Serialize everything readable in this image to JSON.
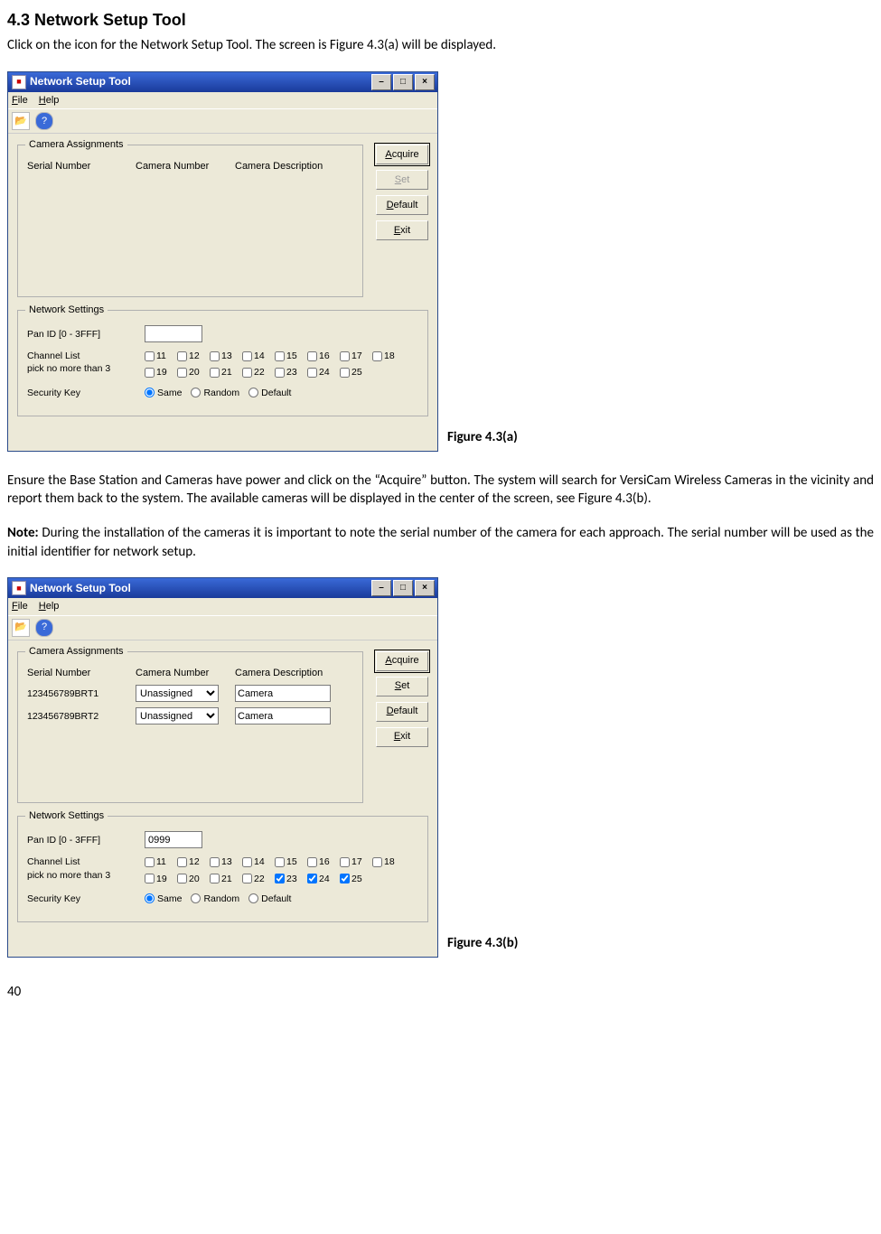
{
  "doc": {
    "heading": "4.3 Network Setup Tool",
    "intro": "Click on the icon for the Network Setup Tool. The screen is Figure 4.3(a) will be displayed.",
    "caption_a": "Figure 4.3(a)",
    "para2": "Ensure the Base Station and Cameras have power and click on the “Acquire” button. The system will search for VersiCam Wireless Cameras in the vicinity and report them back to the system. The available cameras will be displayed in the center of the screen, see Figure 4.3(b).",
    "note_label": "Note:",
    "note_body": " During the installation of the cameras it is important to note the serial number of the camera for each approach. The serial number will be used as the initial identifier for network setup.",
    "caption_b": "Figure 4.3(b)",
    "page_num": "40"
  },
  "win": {
    "title": "Network Setup Tool",
    "minimize": "–",
    "maximize": "□",
    "close": "×",
    "menu_file": "File",
    "menu_help": "Help",
    "group_assign": "Camera Assignments",
    "col_serial": "Serial Number",
    "col_camnum": "Camera Number",
    "col_desc": "Camera Description",
    "btn_acquire": "Acquire",
    "btn_set": "Set",
    "btn_default": "Default",
    "btn_exit": "Exit",
    "group_net": "Network Settings",
    "label_pan": "Pan ID [0 - 3FFF]",
    "label_chanlist": "Channel List",
    "label_chanlist2": "pick no more than 3",
    "label_seckey": "Security Key",
    "radio_same": "Same",
    "radio_random": "Random",
    "radio_default": "Default",
    "channels": [
      "11",
      "12",
      "13",
      "14",
      "15",
      "16",
      "17",
      "18",
      "19",
      "20",
      "21",
      "22",
      "23",
      "24",
      "25"
    ]
  },
  "figA": {
    "pan_value": "",
    "checked_channels": [],
    "rows": []
  },
  "figB": {
    "pan_value": "0999",
    "checked_channels": [
      "23",
      "24",
      "25"
    ],
    "rows": [
      {
        "serial": "123456789BRT1",
        "camnum": "Unassigned",
        "desc": "Camera"
      },
      {
        "serial": "123456789BRT2",
        "camnum": "Unassigned",
        "desc": "Camera"
      }
    ]
  }
}
